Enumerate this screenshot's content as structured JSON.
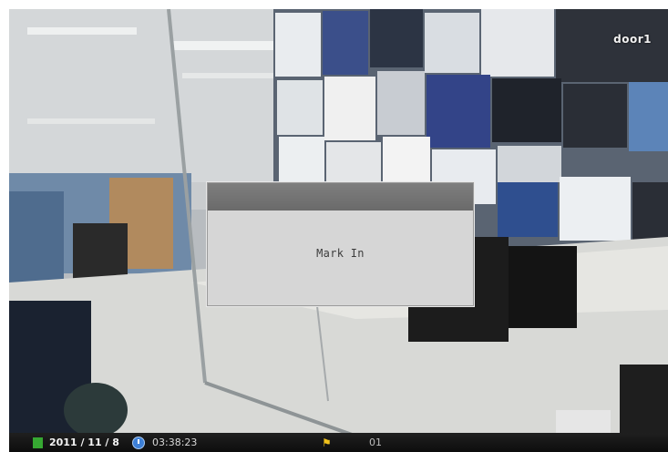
{
  "camera": {
    "name": "door1"
  },
  "dialog": {
    "message": "Mark In"
  },
  "status": {
    "date": "2011 / 11 / 8",
    "time": "03:38:23",
    "channel": "01"
  },
  "colors": {
    "recording_indicator": "#36a832",
    "clock_icon": "#3d7fd6",
    "dialog_titlebar": "#6e6e6e",
    "dialog_body": "#d6d6d6"
  },
  "icons": {
    "recording": "green-square-icon",
    "clock": "clock-icon",
    "event": "flag-icon"
  }
}
